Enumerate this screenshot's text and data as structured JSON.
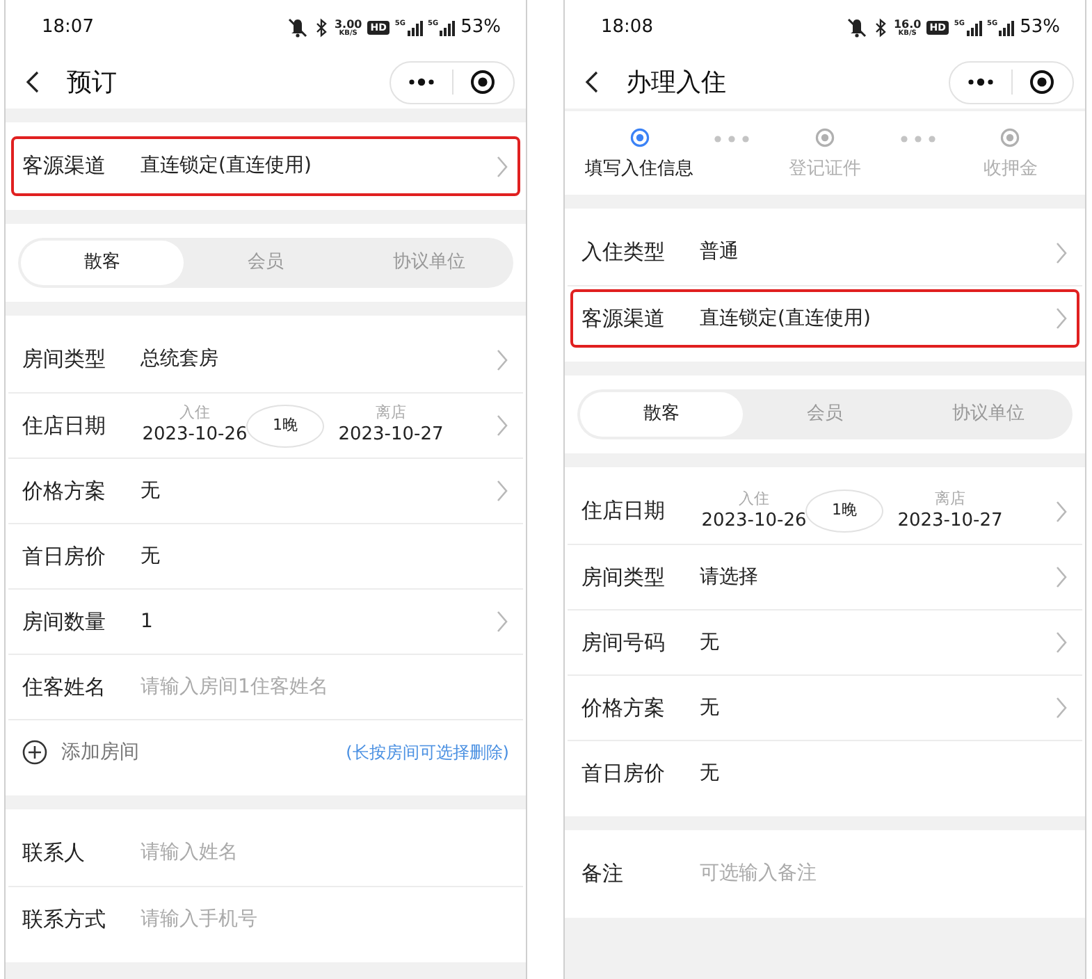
{
  "screens": [
    {
      "status_bar": {
        "time": "18:07",
        "speed": "3.00",
        "speed_unit": "KB/S",
        "hd": "HD",
        "networks": [
          "5G",
          "5G"
        ],
        "battery": "53%"
      },
      "title": "预订",
      "sections": [
        {
          "kind": "rows",
          "rows": [
            {
              "kind": "select",
              "label": "客源渠道",
              "value": "直连锁定(直连使用)",
              "chevron": true,
              "highlighted": true
            }
          ]
        },
        {
          "kind": "segment",
          "options": [
            {
              "label": "散客",
              "selected": true
            },
            {
              "label": "会员",
              "selected": false
            },
            {
              "label": "协议单位",
              "selected": false
            }
          ]
        },
        {
          "kind": "rows",
          "rows": [
            {
              "kind": "select",
              "label": "房间类型",
              "value": "总统套房",
              "chevron": true,
              "highlighted": false
            },
            {
              "kind": "date",
              "label": "住店日期",
              "checkin_label": "入住",
              "checkin": "2023-10-26",
              "nights": "1晚",
              "checkout_label": "离店",
              "checkout": "2023-10-27",
              "chevron": true,
              "highlighted": false
            },
            {
              "kind": "select",
              "label": "价格方案",
              "value": "无",
              "chevron": true,
              "highlighted": false
            },
            {
              "kind": "select",
              "label": "首日房价",
              "value": "无",
              "chevron": false,
              "highlighted": false
            },
            {
              "kind": "select",
              "label": "房间数量",
              "value": "1",
              "chevron": true,
              "highlighted": false
            },
            {
              "kind": "input",
              "label": "住客姓名",
              "placeholder": "请输入房间1住客姓名",
              "highlighted": false
            },
            {
              "kind": "add",
              "label": "添加房间",
              "hint": "(长按房间可选择删除)",
              "highlighted": false
            }
          ]
        },
        {
          "kind": "rows",
          "rows": [
            {
              "kind": "input",
              "label": "联系人",
              "placeholder": "请输入姓名",
              "highlighted": false
            },
            {
              "kind": "input",
              "label": "联系方式",
              "placeholder": "请输入手机号",
              "highlighted": false
            }
          ]
        }
      ]
    },
    {
      "status_bar": {
        "time": "18:08",
        "speed": "16.0",
        "speed_unit": "KB/S",
        "hd": "HD",
        "networks": [
          "5G",
          "5G"
        ],
        "battery": "53%"
      },
      "title": "办理入住",
      "steps": [
        {
          "label": "填写入住信息",
          "selected": true
        },
        {
          "label": "登记证件",
          "selected": false
        },
        {
          "label": "收押金",
          "selected": false
        }
      ],
      "sections": [
        {
          "kind": "rows",
          "rows": [
            {
              "kind": "select",
              "label": "入住类型",
              "value": "普通",
              "chevron": true,
              "highlighted": false
            },
            {
              "kind": "select",
              "label": "客源渠道",
              "value": "直连锁定(直连使用)",
              "chevron": true,
              "highlighted": true
            }
          ]
        },
        {
          "kind": "segment",
          "options": [
            {
              "label": "散客",
              "selected": true
            },
            {
              "label": "会员",
              "selected": false
            },
            {
              "label": "协议单位",
              "selected": false
            }
          ]
        },
        {
          "kind": "rows",
          "rows": [
            {
              "kind": "date",
              "label": "住店日期",
              "checkin_label": "入住",
              "checkin": "2023-10-26",
              "nights": "1晚",
              "checkout_label": "离店",
              "checkout": "2023-10-27",
              "chevron": true,
              "highlighted": false
            },
            {
              "kind": "select",
              "label": "房间类型",
              "value": "请选择",
              "chevron": true,
              "highlighted": false
            },
            {
              "kind": "select",
              "label": "房间号码",
              "value": "无",
              "chevron": true,
              "highlighted": false
            },
            {
              "kind": "select",
              "label": "价格方案",
              "value": "无",
              "chevron": true,
              "highlighted": false
            },
            {
              "kind": "select",
              "label": "首日房价",
              "value": "无",
              "chevron": false,
              "highlighted": false
            }
          ]
        },
        {
          "kind": "rows",
          "rows": [
            {
              "kind": "input",
              "label": "备注",
              "placeholder": "可选输入备注",
              "highlighted": false
            }
          ]
        }
      ]
    }
  ]
}
